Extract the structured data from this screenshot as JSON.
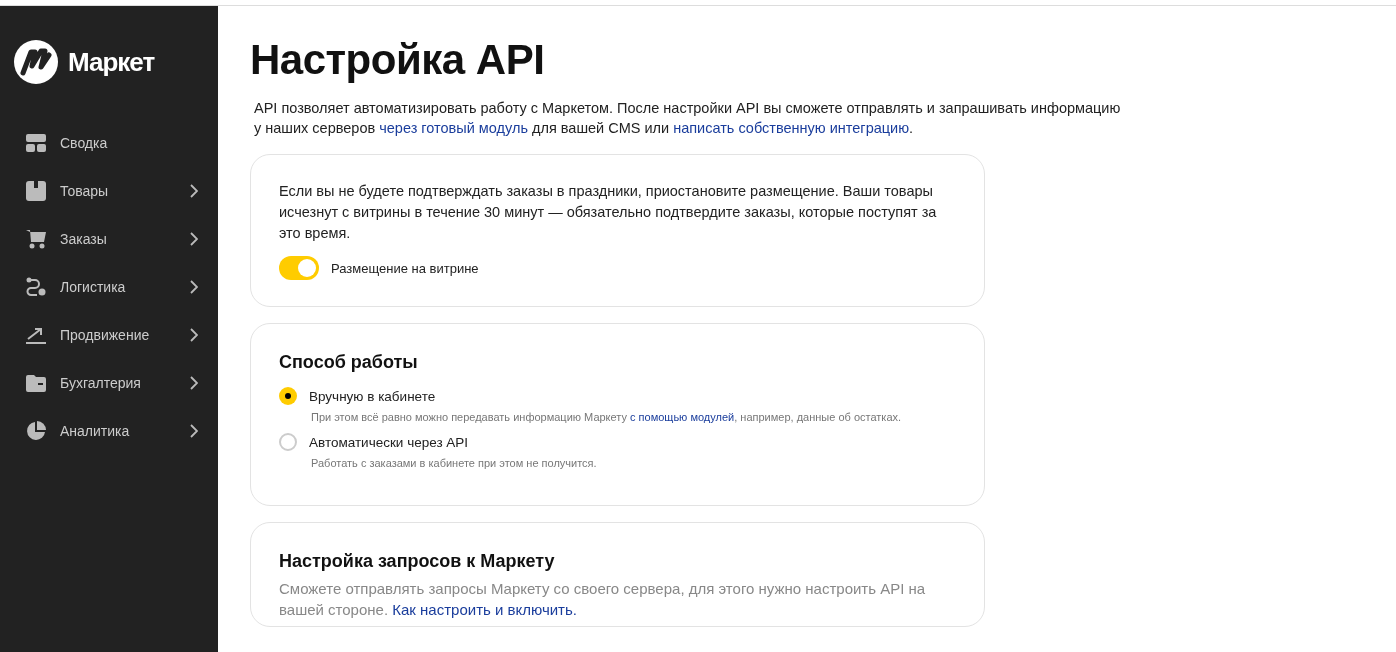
{
  "sidebar": {
    "logo": "Маркет",
    "items": [
      {
        "label": "Сводка",
        "has_submenu": false
      },
      {
        "label": "Товары",
        "has_submenu": true
      },
      {
        "label": "Заказы",
        "has_submenu": true
      },
      {
        "label": "Логистика",
        "has_submenu": true
      },
      {
        "label": "Продвижение",
        "has_submenu": true
      },
      {
        "label": "Бухгалтерия",
        "has_submenu": true
      },
      {
        "label": "Аналитика",
        "has_submenu": true
      }
    ]
  },
  "title": "Настройка API",
  "intro": [
    {
      "text": "API позволяет автоматизировать работу с Маркетом. После настройки API вы сможете отправлять и запрашивать информацию у наших серверов ",
      "link": false
    },
    {
      "text": "через готовый модуль",
      "link": true
    },
    {
      "text": " для вашей CMS или ",
      "link": false
    },
    {
      "text": "написать собственную интеграцию",
      "link": true
    },
    {
      "text": ".",
      "link": false
    }
  ],
  "placement_card": {
    "text": "Если вы не будете подтверждать заказы в праздники, приостановите размещение. Ваши товары исчезнут с витрины в течение 30 минут — обязательно подтвердите заказы, которые поступят за это время.",
    "toggle": {
      "label": "Размещение на витрине",
      "on": true
    }
  },
  "mode_card": {
    "title": "Способ работы",
    "options": [
      {
        "label": "Вручную в кабинете",
        "selected": true,
        "hint": [
          {
            "text": "При этом всё равно можно передавать информацию Маркету ",
            "link": false
          },
          {
            "text": "с помощью модулей",
            "link": true
          },
          {
            "text": ", например, данные об остатках.",
            "link": false
          }
        ]
      },
      {
        "label": "Автоматически через API",
        "selected": false,
        "hint": [
          {
            "text": "Работать с заказами в кабинете при этом не получится.",
            "link": false
          }
        ]
      }
    ]
  },
  "requests_card": {
    "title": "Настройка запросов к Маркету",
    "text": [
      {
        "text": "Сможете отправлять запросы Маркету со своего сервера, для этого нужно настроить API на вашей стороне. ",
        "link": false
      },
      {
        "text": "Как настроить и включить.",
        "link": true
      }
    ]
  }
}
